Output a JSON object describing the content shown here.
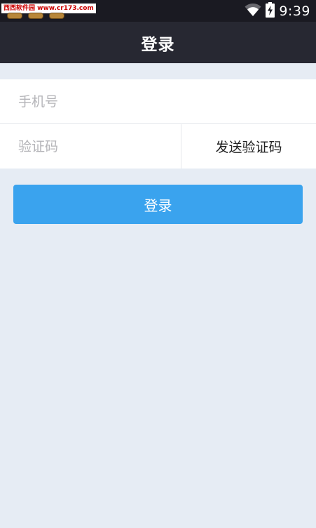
{
  "status_bar": {
    "watermark": "西西软件园 www.cr173.com",
    "time": "9:39",
    "icons": [
      "wifi-icon",
      "battery-charging-icon"
    ],
    "background": "#1a1a22"
  },
  "app_bar": {
    "title": "登录",
    "background": "#272832"
  },
  "form": {
    "phone": {
      "placeholder": "手机号",
      "value": ""
    },
    "code": {
      "placeholder": "验证码",
      "value": ""
    },
    "send_code_label": "发送验证码"
  },
  "login_button": {
    "label": "登录",
    "color": "#3aa3ee"
  },
  "page_background": "#e6ecf4"
}
